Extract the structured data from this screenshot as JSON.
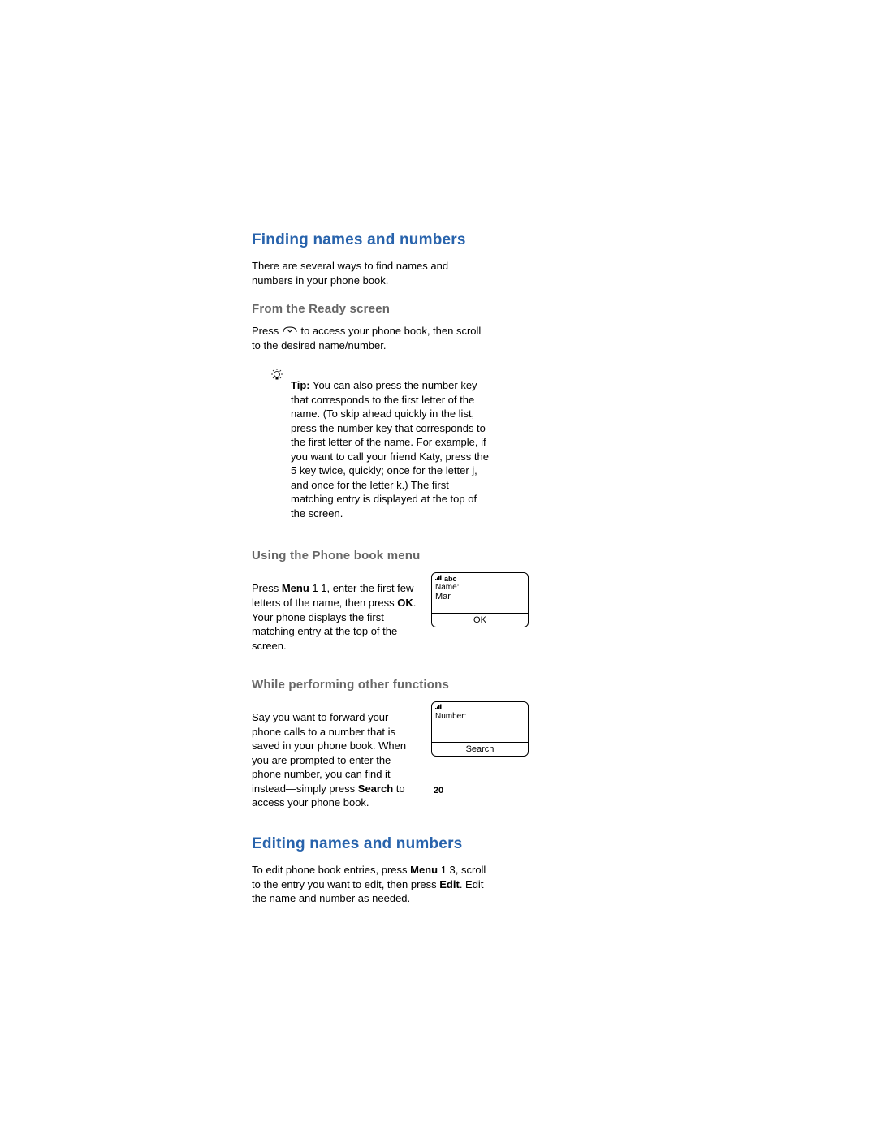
{
  "section1": {
    "heading": "Finding names and numbers",
    "intro": "There are several ways to find names and numbers in your phone book."
  },
  "sub1": {
    "heading": "From the Ready screen",
    "text_before_icon": "Press ",
    "text_after_icon": " to access your phone book, then scroll to the desired name/number.",
    "tip_label": "Tip:",
    "tip_body": "  You can also press the number key that corresponds to the first letter of the name. (To skip ahead quickly in the list, press the number key that corresponds to the first letter of the name. For example, if you want to call your friend Katy, press the 5 key twice, quickly; once for the letter j, and once for the letter k.) The first matching entry is displayed at the top of the screen."
  },
  "sub2": {
    "heading": "Using the Phone book menu",
    "p1": "Press ",
    "b1": "Menu",
    "p2": " 1 1, enter the first few letters of the name, then press ",
    "b2": "OK",
    "p3": ". Your phone displays the first matching entry at the top of the screen.",
    "screen_mode": "abc",
    "screen_label": "Name:",
    "screen_value": "Mar",
    "screen_btn": "OK"
  },
  "sub3": {
    "heading": "While performing other functions",
    "p1": "Say you want to forward your phone calls to a number that is saved in your phone book. When you are prompted to enter the phone number, you can find it instead—simply press ",
    "b1": "Search",
    "p2": " to access your phone book.",
    "screen_label": "Number:",
    "screen_btn": "Search"
  },
  "section2": {
    "heading": "Editing names and numbers",
    "p1": "To edit phone book entries, press ",
    "b1": "Menu",
    "p2": " 1 3, scroll to the entry you want to edit, then press ",
    "b2": "Edit",
    "p3": ". Edit the name and number as needed."
  },
  "page_number": "20"
}
